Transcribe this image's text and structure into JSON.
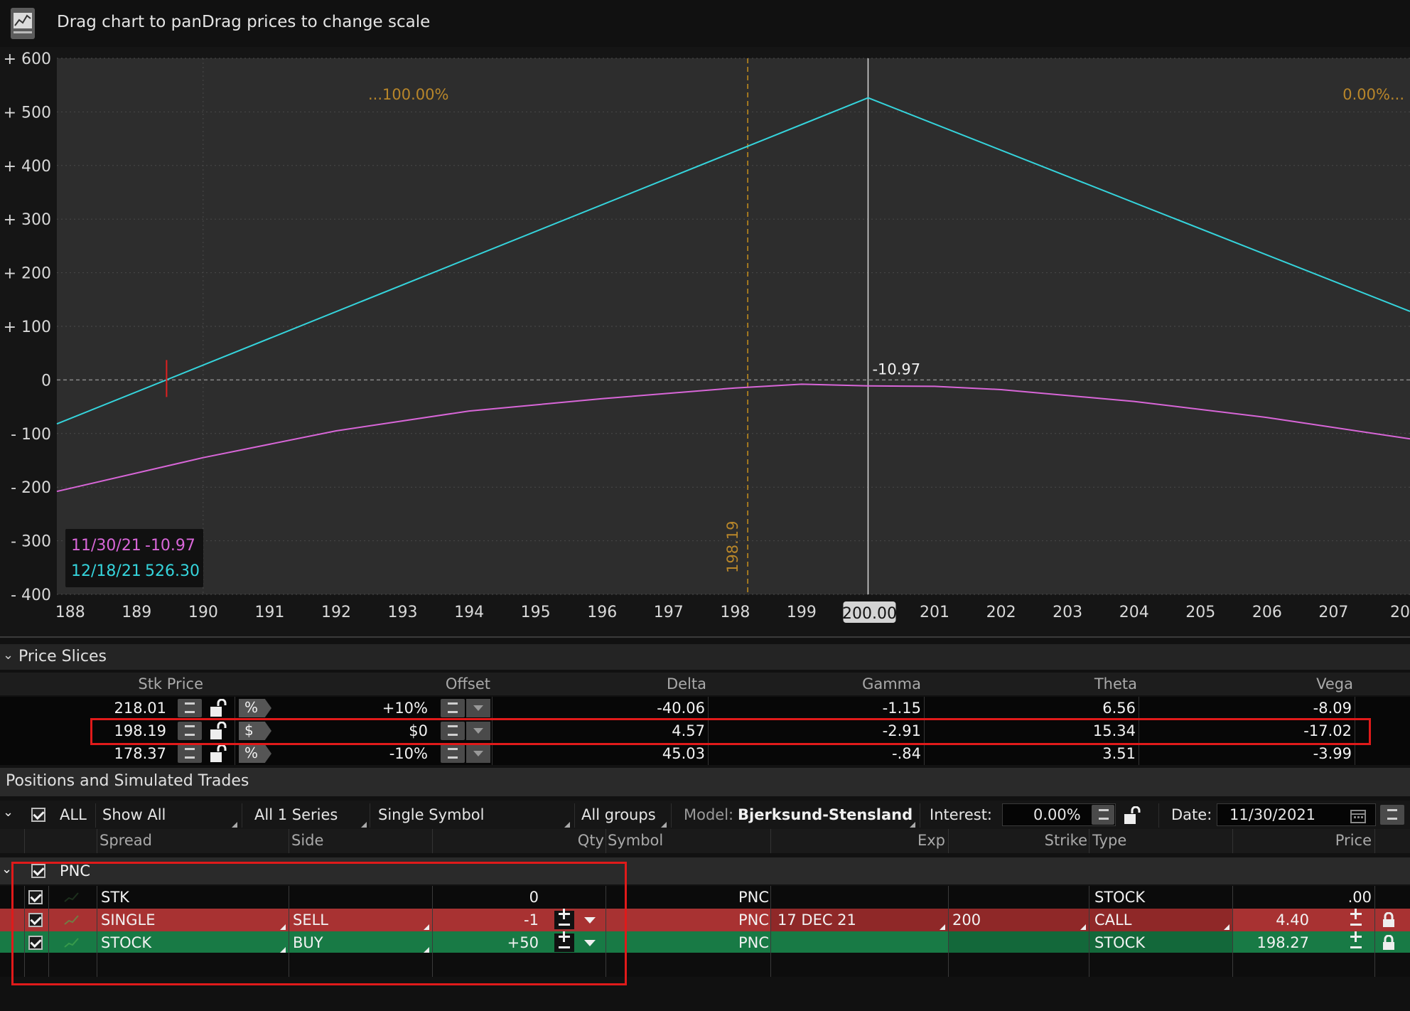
{
  "window": {
    "title": "Drag chart to panDrag prices to change scale"
  },
  "chart_data": {
    "type": "line",
    "x_ticks": [
      "188",
      "189",
      "190",
      "191",
      "192",
      "193",
      "194",
      "195",
      "196",
      "197",
      "198",
      "199",
      "200.00",
      "201",
      "202",
      "203",
      "204",
      "205",
      "206",
      "207",
      "20"
    ],
    "y_ticks": [
      "+ 600",
      "+ 500",
      "+ 400",
      "+ 300",
      "+ 200",
      "+ 100",
      "0",
      "- 100",
      "- 200",
      "- 300",
      "- 400"
    ],
    "xlim": [
      187.8,
      208.15
    ],
    "ylim": [
      -400,
      600
    ],
    "grid": true,
    "series": [
      {
        "name": "12/18/21",
        "color": "#35d4dc",
        "x": [
          187.8,
          200.0,
          208.15
        ],
        "y": [
          -82,
          526.3,
          128
        ]
      },
      {
        "name": "11/30/21",
        "color": "#d866d8",
        "x": [
          187.8,
          190,
          192,
          194,
          196,
          198,
          199,
          200,
          201,
          202,
          204,
          206,
          208.15
        ],
        "y": [
          -208,
          -145,
          -95,
          -58,
          -35,
          -15,
          -8,
          -10.97,
          -12,
          -18,
          -40,
          -70,
          -110
        ]
      }
    ],
    "current_price_line": {
      "x": 198.19,
      "label": "198.19",
      "color": "#c8901c"
    },
    "cursor_line": {
      "x": 200.0,
      "label": "200.00",
      "value_label": "-10.97"
    },
    "breakeven_marker": {
      "x": 189.45,
      "color": "#e02020"
    },
    "annotations": {
      "left": "...100.00%",
      "right": "0.00%..."
    },
    "legend": [
      {
        "date": "11/30/21",
        "value": "-10.97",
        "color": "#d866d8"
      },
      {
        "date": "12/18/21",
        "value": "526.30",
        "color": "#35d4dc"
      }
    ]
  },
  "price_slices": {
    "title": "Price Slices",
    "headers": {
      "stk_price": "Stk Price",
      "offset": "Offset",
      "delta": "Delta",
      "gamma": "Gamma",
      "theta": "Theta",
      "vega": "Vega"
    },
    "rows": [
      {
        "stk_price": "218.01",
        "unit": "%",
        "offset": "+10%",
        "delta": "-40.06",
        "gamma": "-1.15",
        "theta": "6.56",
        "vega": "-8.09"
      },
      {
        "stk_price": "198.19",
        "unit": "$",
        "offset": "$0",
        "delta": "4.57",
        "gamma": "-2.91",
        "theta": "15.34",
        "vega": "-17.02"
      },
      {
        "stk_price": "178.37",
        "unit": "%",
        "offset": "-10%",
        "delta": "45.03",
        "gamma": "-.84",
        "theta": "3.51",
        "vega": "-3.99"
      }
    ]
  },
  "positions": {
    "title": "Positions and Simulated Trades",
    "toolbar": {
      "all": "ALL",
      "show_all": "Show All",
      "series": "All 1 Series",
      "symbol_mode": "Single Symbol",
      "groups": "All groups",
      "model_label": "Model:",
      "model_value": "Bjerksund-Stensland",
      "interest_label": "Interest:",
      "interest_value": "0.00%",
      "date_label": "Date:",
      "date_value": "11/30/2021"
    },
    "headers": {
      "spread": "Spread",
      "side": "Side",
      "qty": "Qty",
      "symbol": "Symbol",
      "exp": "Exp",
      "strike": "Strike",
      "type": "Type",
      "price": "Price"
    },
    "group": "PNC",
    "rows": [
      {
        "spread": "STK",
        "side": "",
        "qty": "0",
        "symbol": "PNC",
        "exp": "",
        "strike": "",
        "type": "STOCK",
        "price": ".00"
      },
      {
        "spread": "SINGLE",
        "side": "SELL",
        "qty": "-1",
        "symbol": "PNC",
        "exp": "17 DEC 21",
        "strike": "200",
        "type": "CALL",
        "price": "4.40"
      },
      {
        "spread": "STOCK",
        "side": "BUY",
        "qty": "+50",
        "symbol": "PNC",
        "exp": "",
        "strike": "",
        "type": "STOCK",
        "price": "198.27"
      }
    ]
  }
}
